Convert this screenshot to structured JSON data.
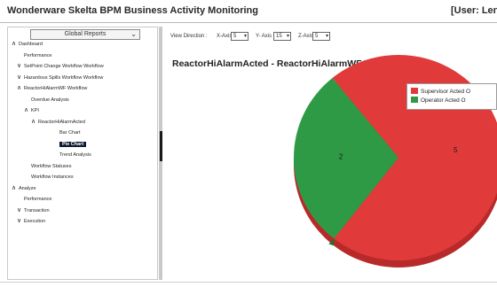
{
  "header": {
    "app_title": "Wonderware Skelta BPM Business Activity Monitoring",
    "user_label": "[User: Len"
  },
  "sidebar": {
    "report_select": "Global Reports",
    "tree": [
      {
        "label": "Dashboard",
        "arrow": "^",
        "level": 0
      },
      {
        "label": "Performance",
        "arrow": "",
        "level": 1
      },
      {
        "label": "SetPoint Change Workflow Workflow",
        "arrow": "v",
        "level": 1
      },
      {
        "label": "Hazardous Spills Workflow Workflow",
        "arrow": "v",
        "level": 1
      },
      {
        "label": "ReactorHiAlarmWF Workflow",
        "arrow": "^",
        "level": 1
      },
      {
        "label": "Overdue Analysis",
        "arrow": "",
        "level": 2
      },
      {
        "label": "KPI",
        "arrow": "^",
        "level": 2
      },
      {
        "label": "ReactorHiAlarmActed",
        "arrow": "^",
        "level": 3
      },
      {
        "label": "Bar Chart",
        "arrow": "",
        "level": 4
      },
      {
        "label": "Pie Chart",
        "arrow": "",
        "level": 4,
        "selected": true
      },
      {
        "label": "Trend Analysis",
        "arrow": "",
        "level": 4
      },
      {
        "label": "Workflow Statuses",
        "arrow": "",
        "level": 2
      },
      {
        "label": "Workflow Instances",
        "arrow": "",
        "level": 2
      },
      {
        "label": "Analyze",
        "arrow": "^",
        "level": 0
      },
      {
        "label": "Performance",
        "arrow": "",
        "level": 1
      },
      {
        "label": "Transaction",
        "arrow": "v",
        "level": 1
      },
      {
        "label": "Execution",
        "arrow": "v",
        "level": 1
      }
    ]
  },
  "controls": {
    "view_direction_label": "View Direction :",
    "x_axis_label": "X-Axis",
    "x_axis_value": "5",
    "y_axis_label": "Y- Axis",
    "y_axis_value": "15",
    "z_axis_label": "Z-Axis",
    "z_axis_value": "5"
  },
  "chart_data": {
    "type": "pie",
    "title": "ReactorHiAlarmActed - ReactorHiAlarmWF Workflow",
    "slices": [
      {
        "name": "Supervisor Acted O",
        "value": 5,
        "color": "#e03a3a"
      },
      {
        "name": "Operator Acted O",
        "value": 2,
        "color": "#2f9a46"
      }
    ],
    "legend_position": "right"
  }
}
